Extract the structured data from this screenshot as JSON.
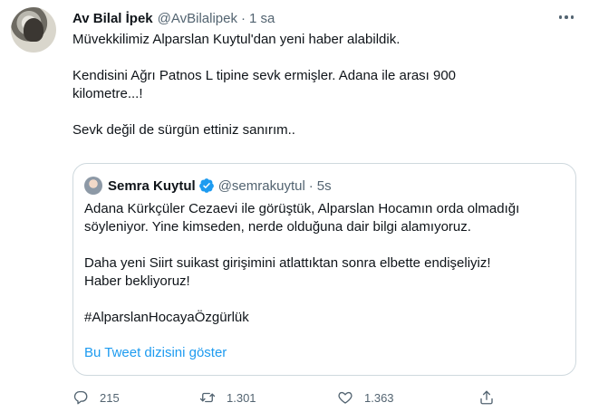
{
  "tweet": {
    "display_name": "Av Bilal İpek",
    "handle": "@AvBilalipek",
    "separator": "·",
    "time": "1 sa",
    "paragraphs": [
      "Müvekkilimiz Alparslan Kuytul'dan yeni haber alabildik.",
      "Kendisini Ağrı Patnos L tipine sevk ermişler. Adana ile arası 900\nkilometre...!",
      "Sevk değil de sürgün ettiniz sanırım.."
    ]
  },
  "quote": {
    "display_name": "Semra Kuytul",
    "handle": "@semrakuytul",
    "separator": "·",
    "time": "5s",
    "paragraphs": [
      "Adana Kürkçüler Cezaevi ile görüştük, Alparslan Hocamın orda olmadığı\nsöyleniyor. Yine kimseden, nerde olduğuna dair bilgi alamıyoruz.",
      "Daha yeni Siirt suikast girişimini atlattıktan sonra elbette endişeliyiz!\nHaber bekliyoruz!",
      "#AlparslanHocayaÖzgürlük"
    ],
    "thread_link": "Bu Tweet dizisini göster"
  },
  "actions": {
    "replies": "215",
    "retweets": "1.301",
    "likes": "1.363"
  },
  "icons": [
    "more-icon",
    "verified-badge-icon",
    "reply-icon",
    "retweet-icon",
    "like-icon",
    "share-icon"
  ],
  "colors": {
    "link": "#1d9bf0",
    "muted": "#536471",
    "text": "#0f1419",
    "border": "#cfd9de"
  }
}
